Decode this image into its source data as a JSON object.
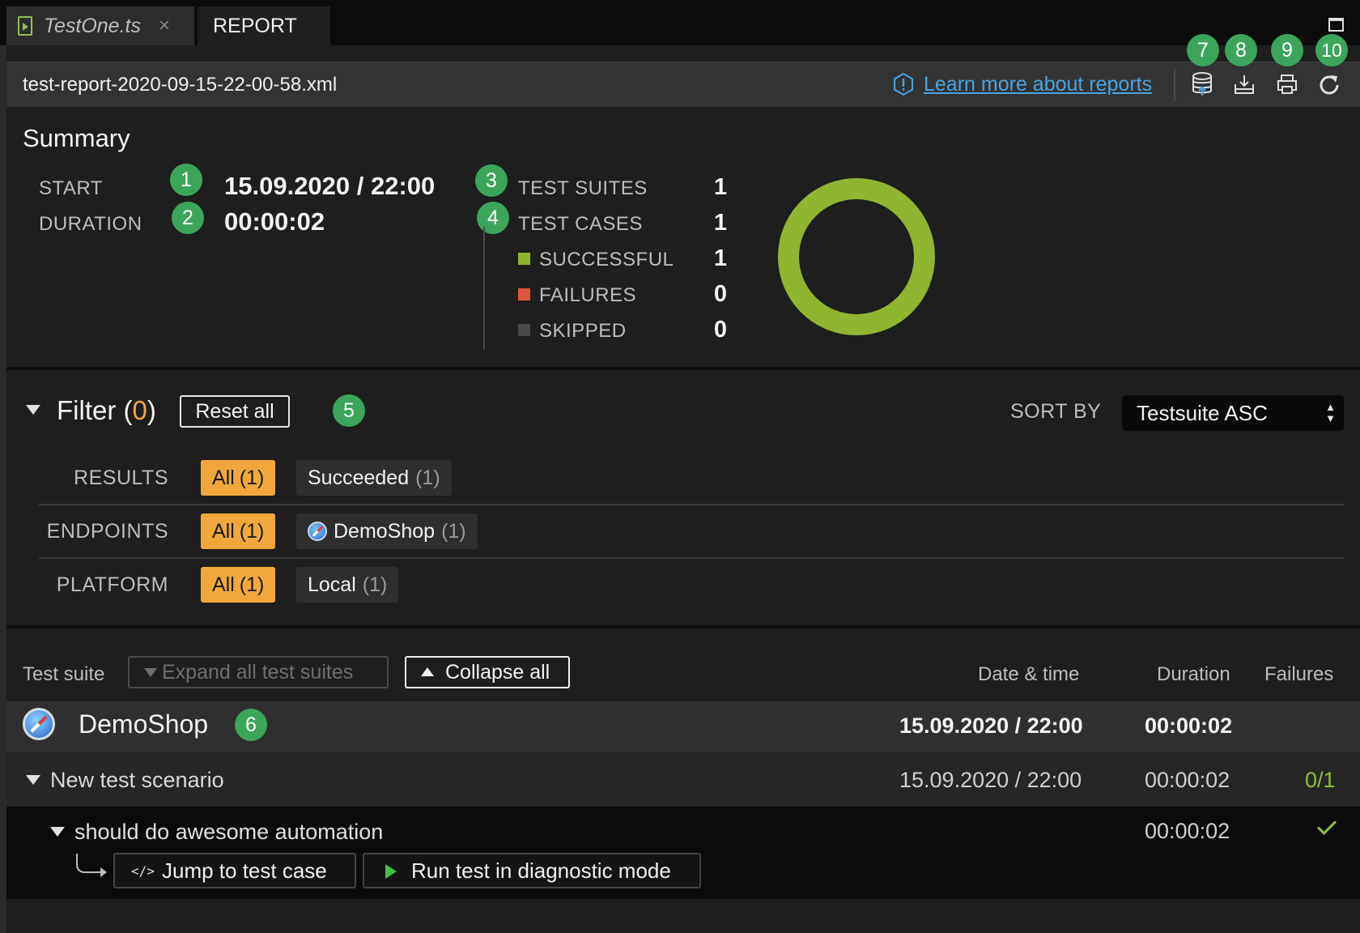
{
  "tabs": [
    {
      "label": "TestOne.ts",
      "close": "×"
    },
    {
      "label": "REPORT"
    }
  ],
  "header": {
    "filename": "test-report-2020-09-15-22-00-58.xml",
    "learn_more": "Learn more about reports",
    "icons": [
      "database-upload-icon",
      "download-icon",
      "print-icon",
      "refresh-icon"
    ]
  },
  "badges": [
    "1",
    "2",
    "3",
    "4",
    "5",
    "6",
    "7",
    "8",
    "9",
    "10"
  ],
  "summary": {
    "title": "Summary",
    "start_label": "START",
    "start_value": "15.09.2020 / 22:00",
    "duration_label": "DURATION",
    "duration_value": "00:00:02",
    "suites_label": "TEST SUITES",
    "suites_value": "1",
    "cases_label": "TEST CASES",
    "cases_value": "1",
    "successful_label": "SUCCESSFUL",
    "successful_value": "1",
    "failures_label": "FAILURES",
    "failures_value": "0",
    "skipped_label": "SKIPPED",
    "skipped_value": "0",
    "donut_success_fraction": 1.0,
    "colors": {
      "success": "#8fb531",
      "failure": "#e0533c",
      "skipped": "#4a4a4a"
    }
  },
  "filter": {
    "title": "Filter",
    "count": "0",
    "reset_label": "Reset all",
    "sort_label": "SORT BY",
    "sort_value": "Testsuite ASC",
    "rows": [
      {
        "label": "RESULTS",
        "chips": [
          {
            "label": "All",
            "count": "(1)",
            "active": true
          },
          {
            "label": "Succeeded",
            "count": "(1)",
            "active": false
          }
        ]
      },
      {
        "label": "ENDPOINTS",
        "chips": [
          {
            "label": "All",
            "count": "(1)",
            "active": true
          },
          {
            "label": "DemoShop",
            "count": "(1)",
            "active": false
          }
        ]
      },
      {
        "label": "PLATFORM",
        "chips": [
          {
            "label": "All",
            "count": "(1)",
            "active": true
          },
          {
            "label": "Local",
            "count": "(1)",
            "active": false
          }
        ]
      }
    ]
  },
  "table": {
    "col_suite": "Test suite",
    "expand_label": "Expand all test suites",
    "collapse_label": "Collapse all",
    "col_date": "Date & time",
    "col_duration": "Duration",
    "col_failures": "Failures",
    "suite": {
      "name": "DemoShop",
      "date": "15.09.2020 / 22:00",
      "duration": "00:00:02"
    },
    "scenario": {
      "name": "New test scenario",
      "date": "15.09.2020 / 22:00",
      "duration": "00:00:02",
      "failures": "0/1"
    },
    "case": {
      "name": "should do awesome automation",
      "duration": "00:00:02",
      "status": "passed"
    },
    "jump_label": "Jump to test case",
    "jump_icon_text": "</>",
    "diag_label": "Run test in diagnostic mode"
  }
}
